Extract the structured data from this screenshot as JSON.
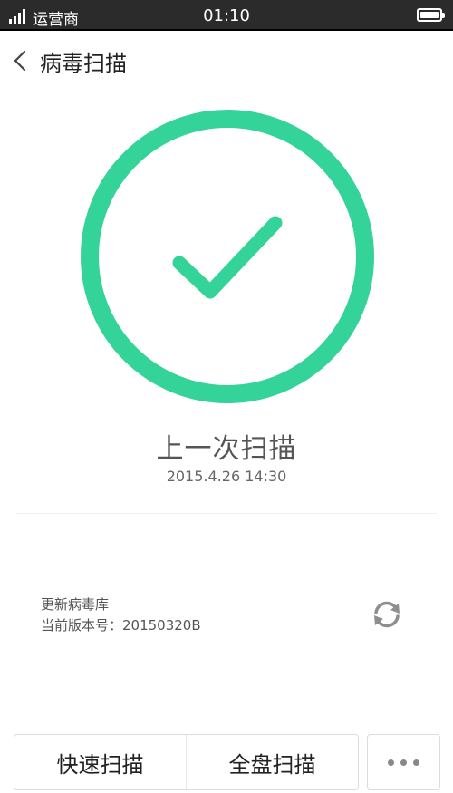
{
  "status_bar": {
    "carrier": "运营商",
    "time": "01:10"
  },
  "header": {
    "title": "病毒扫描",
    "back_icon": "chevron-left-icon"
  },
  "result": {
    "icon": "check-circle-icon",
    "color": "#34d399",
    "title": "上一次扫描",
    "datetime": "2015.4.26 14:30"
  },
  "virus_db": {
    "update_label": "更新病毒库",
    "version_label": "当前版本号：20150320B",
    "refresh_icon": "refresh-icon"
  },
  "actions": {
    "quick_scan": "快速扫描",
    "full_scan": "全盘扫描",
    "more_icon": "more-dots-icon"
  }
}
